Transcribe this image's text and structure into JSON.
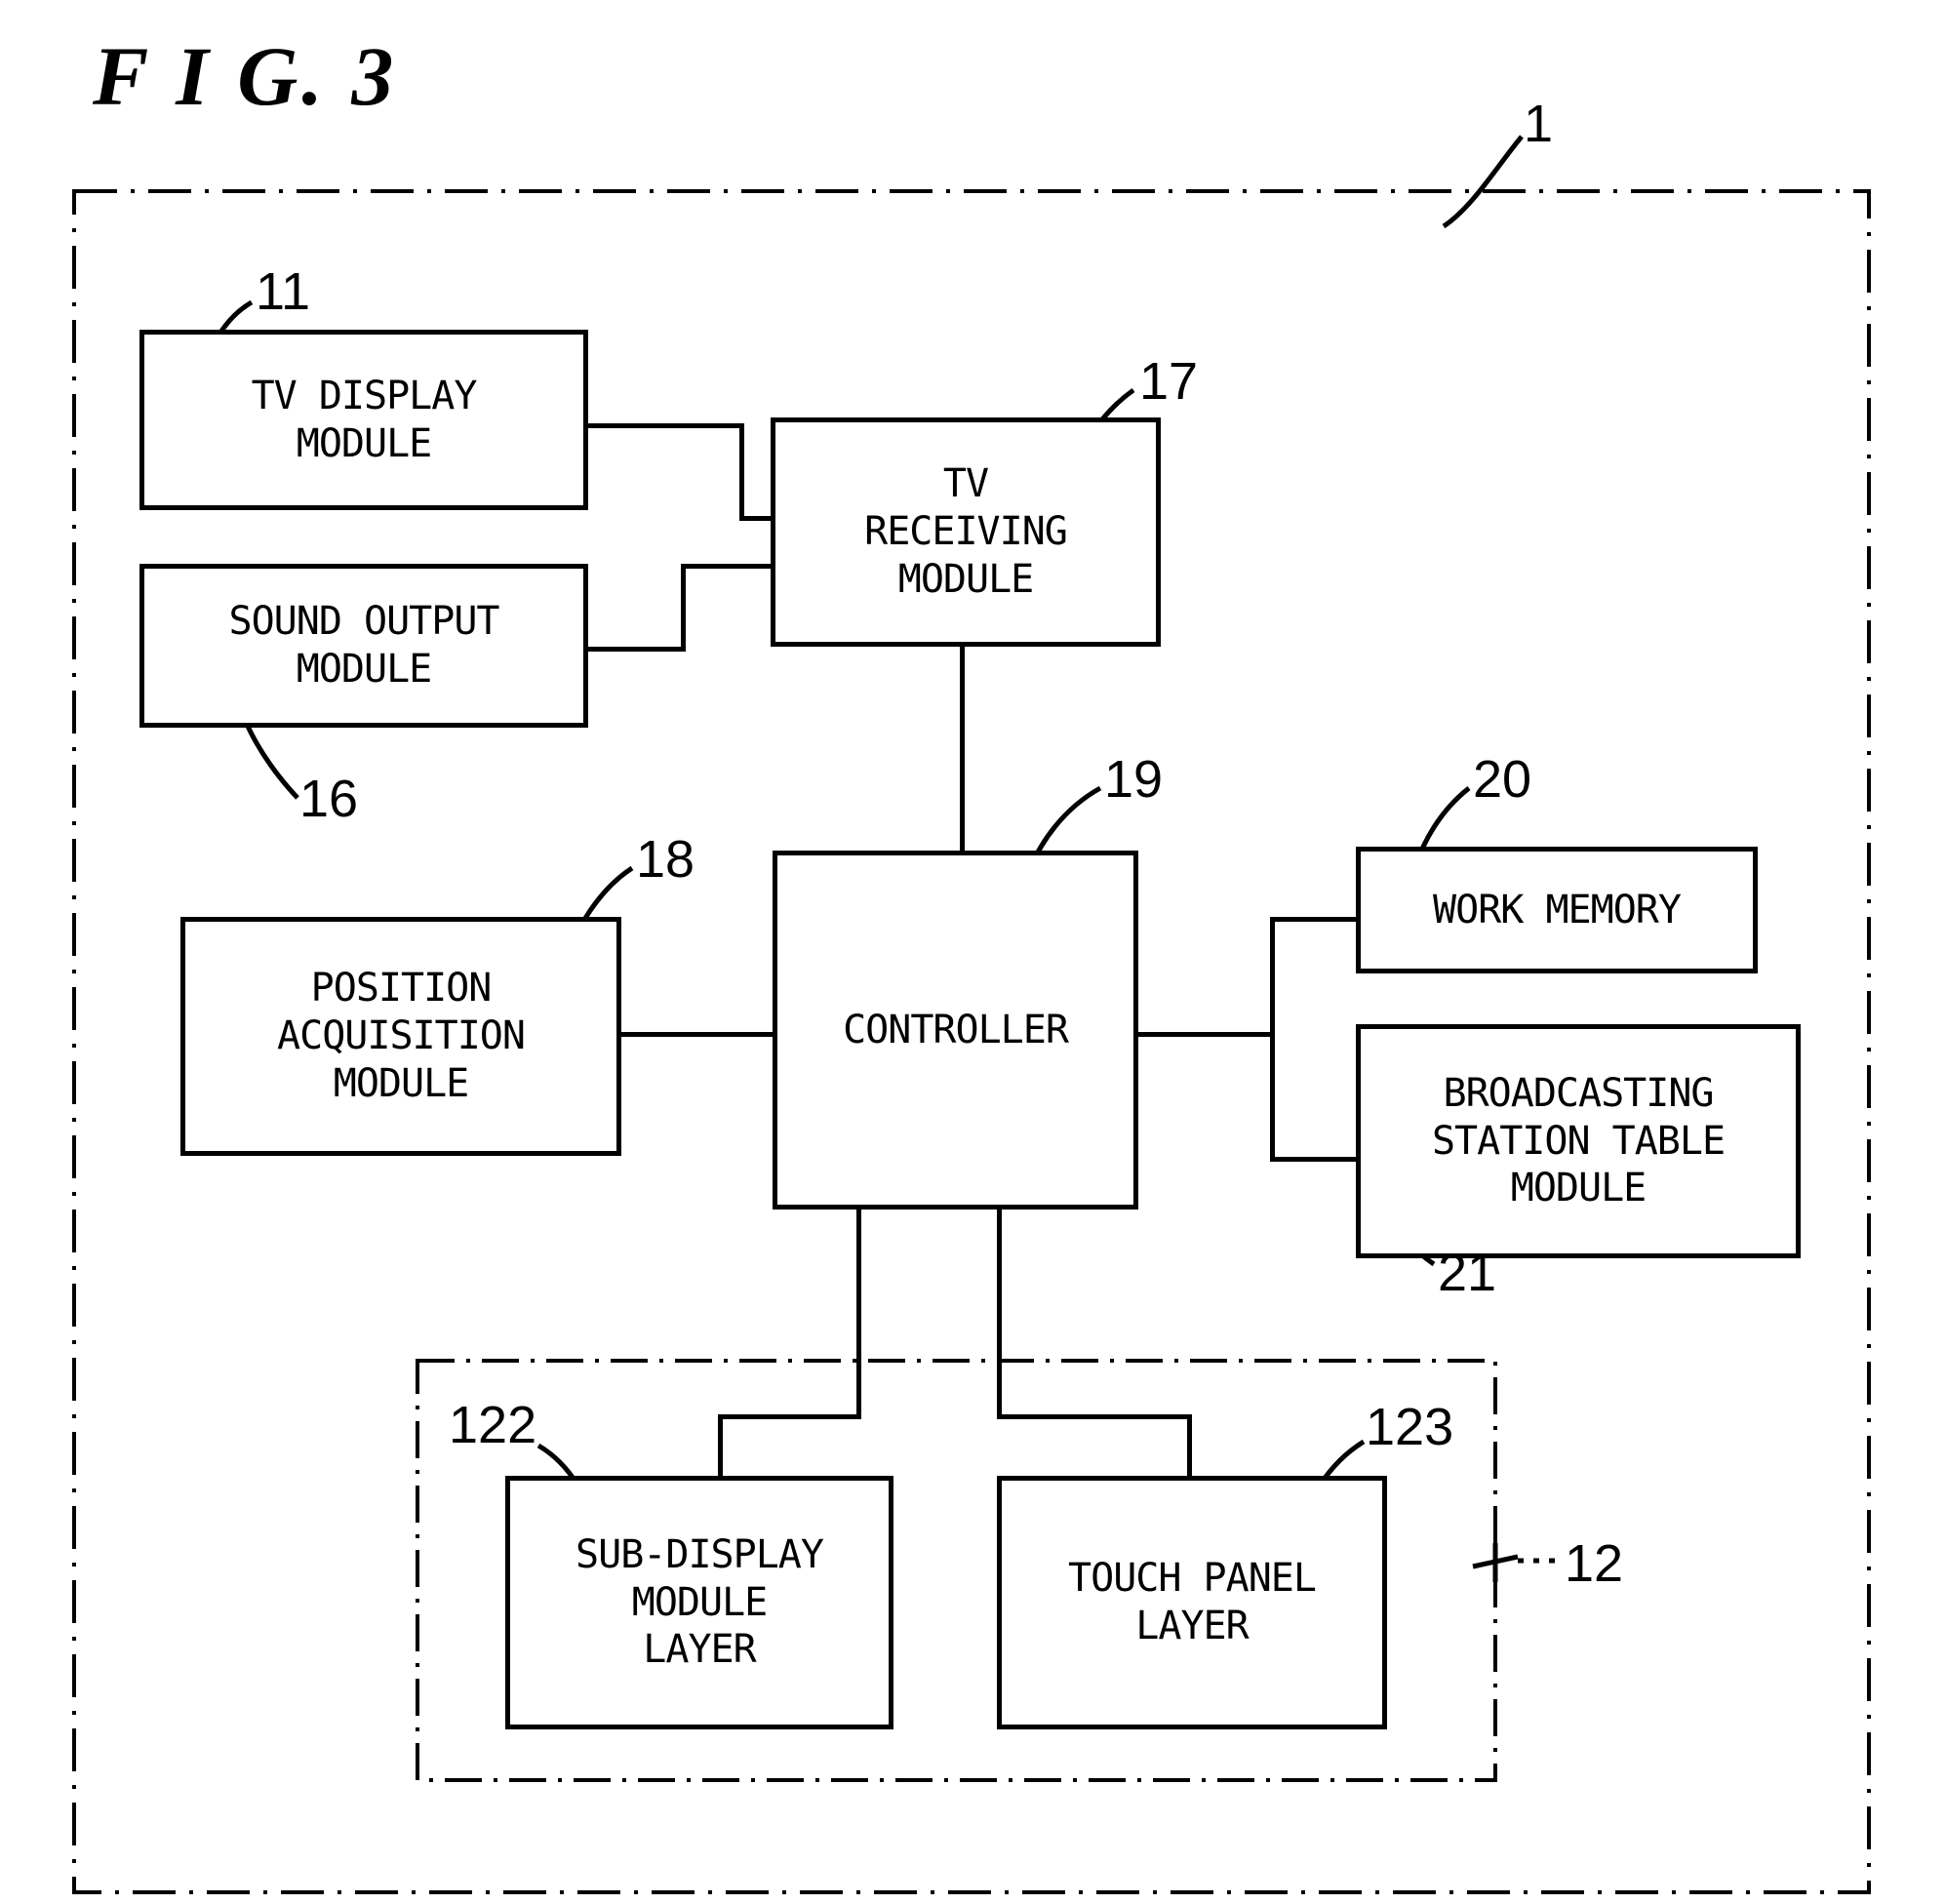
{
  "figure": {
    "title": "F I G. 3",
    "system_ref": "1"
  },
  "blocks": [
    {
      "id": "tv-display-module",
      "label": "TV DISPLAY\nMODULE",
      "ref": "11"
    },
    {
      "id": "sound-output-module",
      "label": "SOUND OUTPUT\nMODULE",
      "ref": "16"
    },
    {
      "id": "tv-receiving-module",
      "label": "TV\nRECEIVING\nMODULE",
      "ref": "17"
    },
    {
      "id": "position-acquisition-module",
      "label": "POSITION\nACQUISITION\nMODULE",
      "ref": "18"
    },
    {
      "id": "controller",
      "label": "CONTROLLER",
      "ref": "19"
    },
    {
      "id": "work-memory",
      "label": "WORK MEMORY",
      "ref": "20"
    },
    {
      "id": "broadcasting-station-table-module",
      "label": "BROADCASTING\nSTATION TABLE\nMODULE",
      "ref": "21"
    },
    {
      "id": "sub-display-module-layer",
      "label": "SUB-DISPLAY\nMODULE\nLAYER",
      "ref": "122"
    },
    {
      "id": "touch-panel-layer",
      "label": "TOUCH PANEL\nLAYER",
      "ref": "123"
    },
    {
      "id": "display-unit-group",
      "label": "",
      "ref": "12"
    }
  ],
  "labels": {
    "tv_display_module": "TV DISPLAY\nMODULE",
    "sound_output_module": "SOUND OUTPUT\nMODULE",
    "tv_receiving_module": "TV\nRECEIVING\nMODULE",
    "position_acquisition_module": "POSITION\nACQUISITION\nMODULE",
    "controller": "CONTROLLER",
    "work_memory": "WORK MEMORY",
    "broadcasting_station_table_module": "BROADCASTING\nSTATION TABLE\nMODULE",
    "sub_display_module_layer": "SUB-DISPLAY\nMODULE\nLAYER",
    "touch_panel_layer": "TOUCH PANEL\nLAYER"
  },
  "refs": {
    "system": "1",
    "tv_display_module": "11",
    "sound_output_module": "16",
    "tv_receiving_module": "17",
    "position_acquisition_module": "18",
    "controller": "19",
    "work_memory": "20",
    "broadcasting_station_table_module": "21",
    "display_unit": "12",
    "sub_display_module_layer": "122",
    "touch_panel_layer": "123"
  },
  "colors": {
    "line": "#000000",
    "background": "#ffffff"
  }
}
